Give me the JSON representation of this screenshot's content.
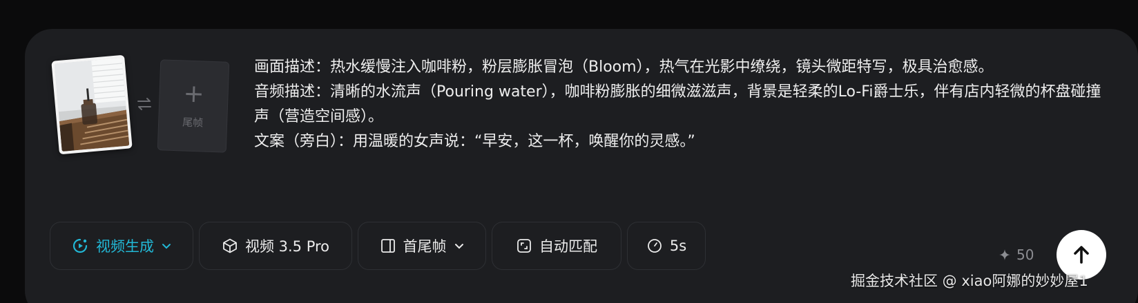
{
  "frames": {
    "last_frame_label": "尾帧"
  },
  "prompt": {
    "lines": [
      "画面描述：热水缓慢注入咖啡粉，粉层膨胀冒泡（Bloom），热气在光影中缭绕，镜头微距特写，极具治愈感。",
      "音频描述：清晰的水流声（Pouring water），咖啡粉膨胀的细微滋滋声，背景是轻柔的Lo-Fi爵士乐，伴有店内轻微的杯盘碰撞声（营造空间感）。",
      "文案（旁白）：用温暖的女声说：“早安，这一杯，唤醒你的灵感。”"
    ]
  },
  "toolbar": {
    "mode_label": "视频生成",
    "model_label": "视频 3.5 Pro",
    "frame_mode_label": "首尾帧",
    "ratio_label": "自动匹配",
    "duration_label": "5s"
  },
  "credits": {
    "value": "50"
  },
  "watermark": "掘金技术社区 @ xiao阿娜的妙妙屋1",
  "colors": {
    "accent": "#22b8d6",
    "panel": "#1d1e21",
    "background": "#0b0b0c"
  }
}
